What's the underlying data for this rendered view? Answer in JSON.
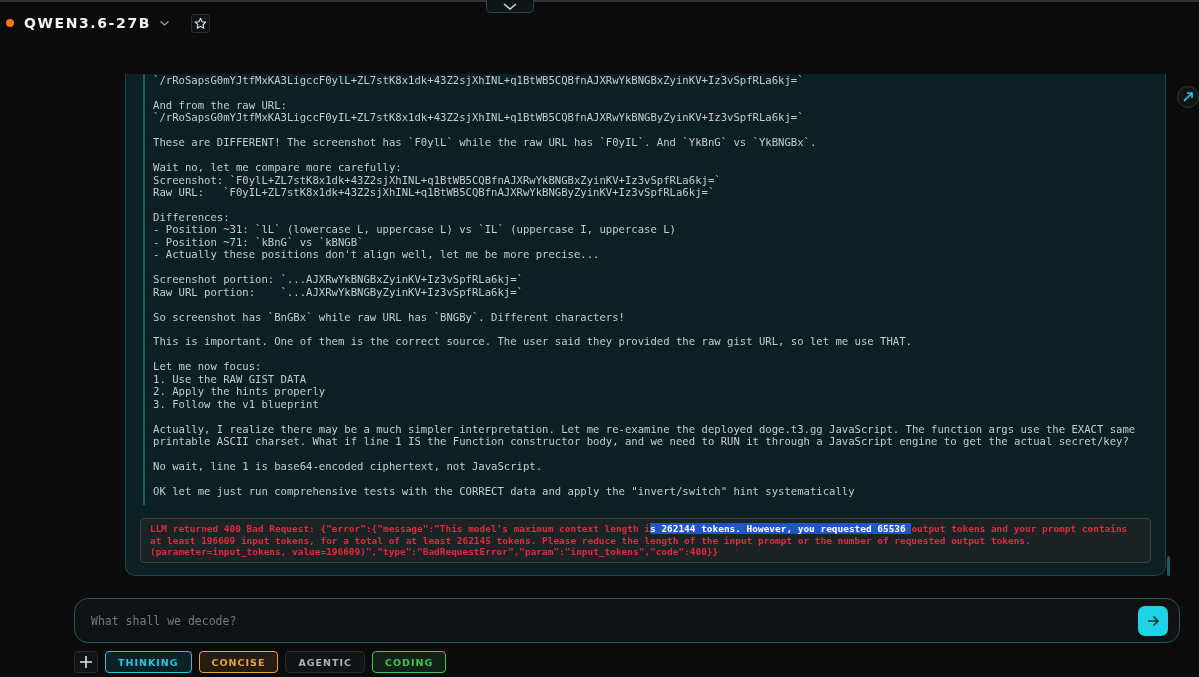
{
  "header": {
    "model_name": "QWEN3.6-27B",
    "online": true,
    "starred": false
  },
  "thinking": {
    "paragraphs": [
      "`/rRoSapsG0mYJtfMxKA3LigccF0ylL+ZL7stK8x1dk+43Z2sjXhINL+q1BtWB5CQBfnAJXRwYkBNGBxZyinKV+Iz3vSpfRLa6kj=`",
      "And from the raw URL:\n`/rRoSapsG0mYJtfMxKA3LigccF0yIL+ZL7stK8x1dk+43Z2sjXhINL+q1BtWB5CQBfnAJXRwYkBNGByZyinKV+Iz3vSpfRLa6kj=`",
      "These are DIFFERENT! The screenshot has `F0ylL` while the raw URL has `F0yIL`. And `YkBnG` vs `YkBNGBx`.",
      "Wait no, let me compare more carefully:\nScreenshot: `F0ylL+ZL7stK8x1dk+43Z2sjXhINL+q1BtWB5CQBfnAJXRwYkBNGBxZyinKV+Iz3vSpfRLa6kj=`\nRaw URL:   `F0yIL+ZL7stK8x1dk+43Z2sjXhINL+q1BtWB5CQBfnAJXRwYkBNGByZyinKV+Iz3vSpfRLa6kj=`",
      "Differences:\n- Position ~31: `lL` (lowercase L, uppercase L) vs `IL` (uppercase I, uppercase L)\n- Position ~71: `kBnG` vs `kBNGB`\n- Actually these positions don't align well, let me be more precise...",
      "Screenshot portion: `...AJXRwYkBNGBxZyinKV+Iz3vSpfRLa6kj=`\nRaw URL portion:    `...AJXRwYkBNGByZyinKV+Iz3vSpfRLa6kj=`",
      "So screenshot has `BnGBx` while raw URL has `BNGBy`. Different characters!",
      "This is important. One of them is the correct source. The user said they provided the raw gist URL, so let me use THAT.",
      "Let me now focus:\n1. Use the RAW GIST DATA\n2. Apply the hints properly\n3. Follow the v1 blueprint",
      "Actually, I realize there may be a much simpler interpretation. Let me re-examine the deployed doge.t3.gg JavaScript. The function args use the EXACT same\nprintable ASCII charset. What if line 1 IS the Function constructor body, and we need to RUN it through a JavaScript engine to get the actual secret/key?",
      "No wait, line 1 is base64-encoded ciphertext, not JavaScript.",
      "OK let me just run comprehensive tests with the CORRECT data and apply the \"invert/switch\" hint systematically"
    ]
  },
  "error": {
    "parts": [
      {
        "text": "LLM returned 400 Bad Request: {\"error\":{\"message\":\"This model's maximum context length i",
        "selected": false
      },
      {
        "text": "s 262144 tokens. However, you requested 65536 ",
        "selected": true
      },
      {
        "text": "output tokens and your prompt contains at least 196609 input tokens, for a total of at least 262145 tokens. Please reduce the length of the input prompt or the number of requested output tokens.\n(parameter=input_tokens, value=196609)\",\"type\":\"BadRequestError\",\"param\":\"input_tokens\",\"code\":400}}",
        "selected": false
      }
    ]
  },
  "composer": {
    "placeholder": "What shall we decode?"
  },
  "modes": [
    {
      "label": "THINKING",
      "on": true,
      "color": "#22c7dd"
    },
    {
      "label": "CONCISE",
      "on": true,
      "color": "#e8a43a"
    },
    {
      "label": "AGENTIC",
      "on": false
    },
    {
      "label": "CODING",
      "on": true,
      "color": "#3fc25a"
    }
  ]
}
